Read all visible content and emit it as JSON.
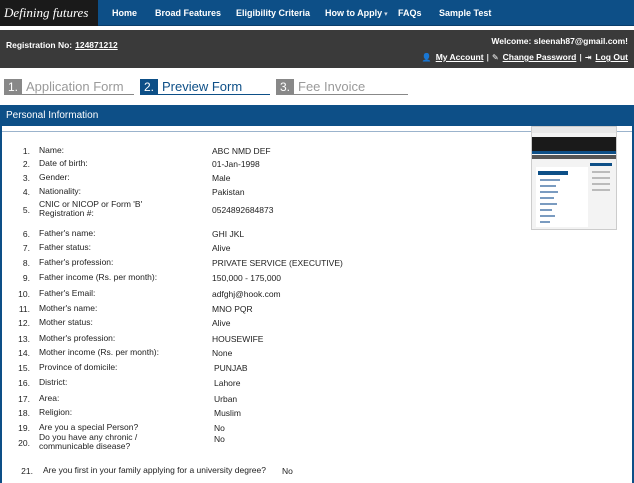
{
  "nav": {
    "brand": "Defining futures",
    "items": [
      "Home",
      "Broad Features",
      "Eligibility Criteria",
      "How to Apply",
      "FAQs",
      "Sample Test"
    ]
  },
  "account": {
    "reg_label": "Registration No:",
    "reg_number": "124871212",
    "welcome": "Welcome: sleenah87@gmail.com!",
    "my_account": "My Account",
    "change_password": "Change Password",
    "logout": "Log Out"
  },
  "steps": [
    {
      "num": "1.",
      "label": "Application Form"
    },
    {
      "num": "2.",
      "label": "Preview Form"
    },
    {
      "num": "3.",
      "label": "Fee Invoice"
    }
  ],
  "active_step": 2,
  "section_title": "Personal Information",
  "fields": [
    {
      "n": "1.",
      "label": "Name:",
      "value": "ABC NMD DEF"
    },
    {
      "n": "2.",
      "label": "Date of birth:",
      "value": "01-Jan-1998"
    },
    {
      "n": "3.",
      "label": "Gender:",
      "value": "Male"
    },
    {
      "n": "4.",
      "label": "Nationality:",
      "value": "Pakistan"
    },
    {
      "n": "5.",
      "label": "CNIC or NICOP or Form 'B' Registration #:",
      "value": "0524892684873"
    },
    {
      "n": "6.",
      "label": "Father's name:",
      "value": "GHI JKL"
    },
    {
      "n": "7.",
      "label": "Father status:",
      "value": "Alive"
    },
    {
      "n": "8.",
      "label": "Father's profession:",
      "value": "PRIVATE SERVICE (EXECUTIVE)"
    },
    {
      "n": "9.",
      "label": "Father income (Rs. per month):",
      "value": "150,000 - 175,000"
    },
    {
      "n": "10.",
      "label": "Father's Email:",
      "value": "adfghj@hook.com"
    },
    {
      "n": "11.",
      "label": "Mother's name:",
      "value": "MNO PQR"
    },
    {
      "n": "12.",
      "label": "Mother status:",
      "value": "Alive"
    },
    {
      "n": "13.",
      "label": "Mother's profession:",
      "value": "HOUSEWIFE"
    },
    {
      "n": "14.",
      "label": "Mother income (Rs. per month):",
      "value": "None"
    },
    {
      "n": "15.",
      "label": "Province of domicile:",
      "value": "PUNJAB"
    },
    {
      "n": "16.",
      "label": "District:",
      "value": "Lahore"
    },
    {
      "n": "17.",
      "label": "Area:",
      "value": "Urban"
    },
    {
      "n": "18.",
      "label": "Religion:",
      "value": "Muslim"
    },
    {
      "n": "19.",
      "label": "Are you a special Person?",
      "value": "No"
    },
    {
      "n": "20.",
      "label": "Do you have any chronic / communicable disease?",
      "value": "No"
    },
    {
      "n": "21.",
      "label": "Are you first in your family applying for a university degree?",
      "value": "No"
    }
  ],
  "colors": {
    "primary": "#0d4f87",
    "dark": "#3a3a3a",
    "brand_bg": "#1a1a1a"
  }
}
